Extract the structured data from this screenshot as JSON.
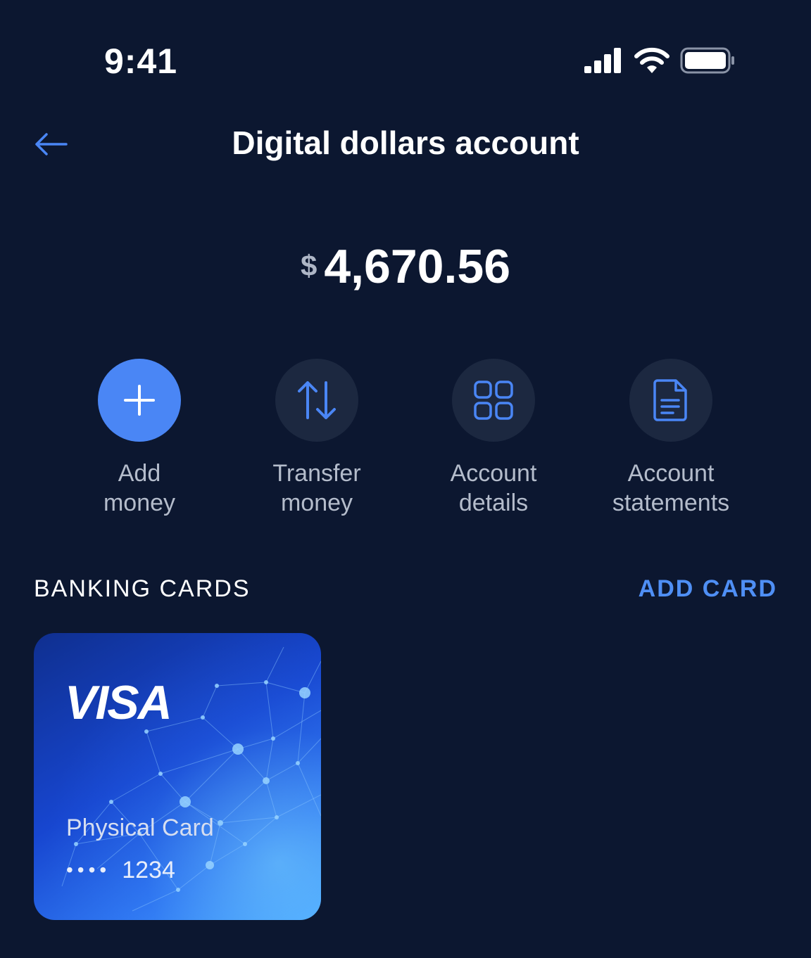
{
  "status_bar": {
    "time": "9:41"
  },
  "nav": {
    "title": "Digital dollars account"
  },
  "balance": {
    "currency_symbol": "$",
    "amount": "4,670.56"
  },
  "actions": [
    {
      "label_line1": "Add",
      "label_line2": "money",
      "icon": "plus-icon"
    },
    {
      "label_line1": "Transfer",
      "label_line2": "money",
      "icon": "transfer-arrows-icon"
    },
    {
      "label_line1": "Account",
      "label_line2": "details",
      "icon": "grid-icon"
    },
    {
      "label_line1": "Account",
      "label_line2": "statements",
      "icon": "document-icon"
    }
  ],
  "banking_cards": {
    "section_title": "BANKING CARDS",
    "add_card_label": "ADD CARD",
    "cards": [
      {
        "brand": "VISA",
        "name": "Physical Card",
        "masked_dots": "••••",
        "last4": "1234"
      }
    ]
  },
  "colors": {
    "background": "#0c1730",
    "accent": "#4a86f5",
    "action_circle": "#1c2840",
    "link": "#4f8ff5"
  }
}
